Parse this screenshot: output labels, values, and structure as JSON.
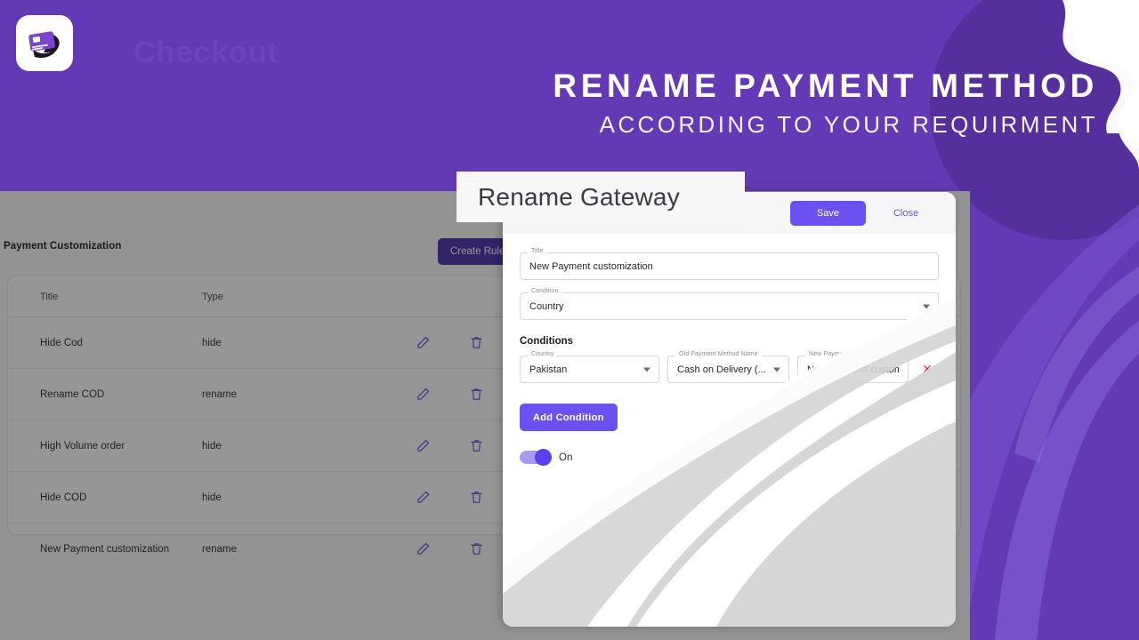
{
  "header": {
    "brand_ghost": "Checkout",
    "headline_main": "RENAME PAYMENT METHOD",
    "headline_sub": "ACCORDING TO YOUR REQUIRMENT",
    "logo_icon": "credit-card-swoosh-icon"
  },
  "callout": {
    "text": "Rename Gateway"
  },
  "app": {
    "page_title": "Payment Customization",
    "create_rule_label": "Create Rule",
    "table": {
      "columns": [
        "Title",
        "Type",
        "",
        ""
      ],
      "rows": [
        {
          "title": "Hide Cod",
          "type": "hide",
          "edit_icon": "pencil-icon",
          "delete_icon": "trash-icon"
        },
        {
          "title": "Rename COD",
          "type": "rename",
          "edit_icon": "pencil-icon",
          "delete_icon": "trash-icon"
        },
        {
          "title": "High Volume order",
          "type": "hide",
          "edit_icon": "pencil-icon",
          "delete_icon": "trash-icon"
        },
        {
          "title": "Hide COD",
          "type": "hide",
          "edit_icon": "pencil-icon",
          "delete_icon": "trash-icon"
        },
        {
          "title": "New Payment customization",
          "type": "rename",
          "edit_icon": "pencil-icon",
          "delete_icon": "trash-icon"
        }
      ]
    }
  },
  "modal": {
    "save_label": "Save",
    "close_label": "Close",
    "title_field": {
      "label": "Title",
      "value": "New Payment customization"
    },
    "condition_field": {
      "label": "Condition",
      "value": "Country"
    },
    "conditions_heading": "Conditions",
    "condition_rows": [
      {
        "country_label": "Country",
        "country_value": "Pakistan",
        "old_label": "Old Payment Method Name",
        "old_value": "Cash on Delivery (...",
        "new_label": "New Payment Method Name",
        "new_value": "New Payment customiz",
        "delete_icon": "close-x-icon"
      }
    ],
    "add_condition_label": "Add Condition",
    "toggle": {
      "label": "On",
      "state": "on"
    }
  },
  "colors": {
    "brand_purple": "#6339b6",
    "accent_purple": "#6c50f0",
    "button_purple": "#4a31a8",
    "delete_red": "#e03b3b",
    "scrim": "rgba(22,22,22,0.45)"
  }
}
